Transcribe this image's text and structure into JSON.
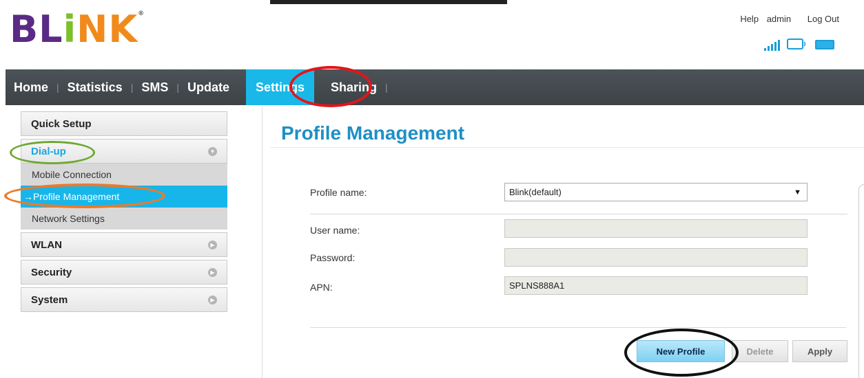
{
  "brand": {
    "logo_b": "B",
    "logo_l": "L",
    "logo_i": "i",
    "logo_n": "N",
    "logo_k": "K",
    "logo_tm": "®"
  },
  "header": {
    "help": "Help",
    "user": "admin",
    "logout": "Log Out"
  },
  "status_icons": [
    "signal-icon",
    "monitor-icon",
    "battery-icon"
  ],
  "nav": {
    "home": "Home",
    "statistics": "Statistics",
    "sms": "SMS",
    "update": "Update",
    "settings": "Settings",
    "sharing": "Sharing",
    "active": "Settings"
  },
  "sidebar": {
    "quick_setup": "Quick Setup",
    "dialup": "Dial-up",
    "dialup_items": [
      "Mobile Connection",
      "Profile Management",
      "Network Settings"
    ],
    "active_prefix": "→",
    "wlan": "WLAN",
    "security": "Security",
    "system": "System"
  },
  "main": {
    "title": "Profile Management",
    "profile_label": "Profile name:",
    "profile_value": "Blink(default)",
    "username_label": "User name:",
    "username_value": "",
    "password_label": "Password:",
    "password_value": "",
    "apn_label": "APN:",
    "apn_value": "SPLNS888A1"
  },
  "buttons": {
    "new_profile": "New Profile",
    "delete": "Delete",
    "apply": "Apply"
  },
  "colors": {
    "accent": "#17b6ea",
    "nav_bg": "#464c50",
    "title": "#1e8fc6",
    "ring_red": "#e5141b",
    "ring_green": "#6ea832",
    "ring_orange": "#ec7a2a",
    "ring_black": "#111111"
  }
}
